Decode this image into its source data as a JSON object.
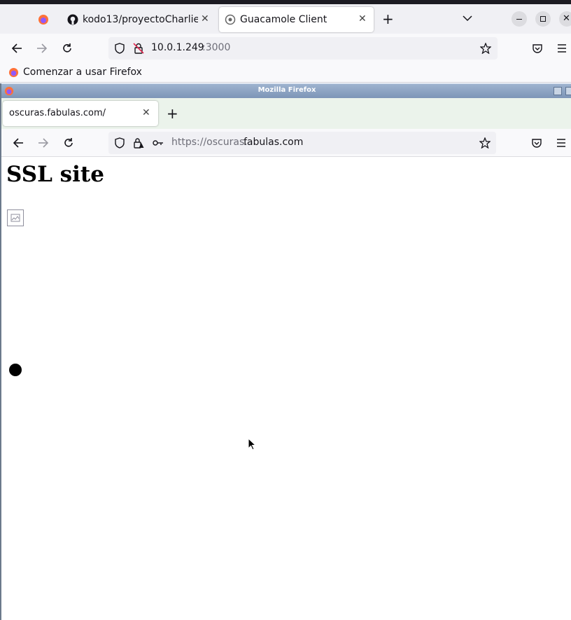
{
  "outer_browser": {
    "tabs": [
      {
        "label": "",
        "icon": "firefox-icon"
      },
      {
        "label": "kodo13/proyectoCharlie",
        "icon": "github-icon"
      },
      {
        "label": "Guacamole Client",
        "icon": "guacamole-icon",
        "active": true
      }
    ],
    "new_tab_label": "+",
    "window_controls": [
      "minimize",
      "maximize",
      "close"
    ],
    "url_host": "10.0.1.249",
    "url_port": ":3000",
    "bookmark_label": "Comenzar a usar Firefox"
  },
  "inner_browser": {
    "window_title": "Mozilla Firefox",
    "tab_label": "oscuras.fabulas.com/",
    "new_tab_label": "+",
    "url_prefix": "https://oscuras.",
    "url_domain": "fabulas.com"
  },
  "page": {
    "heading": "SSL site"
  },
  "colors": {
    "accent": "#0060df",
    "inner_titlebar": "#8aa0c0",
    "inner_tabbar": "#ebf3eb"
  }
}
